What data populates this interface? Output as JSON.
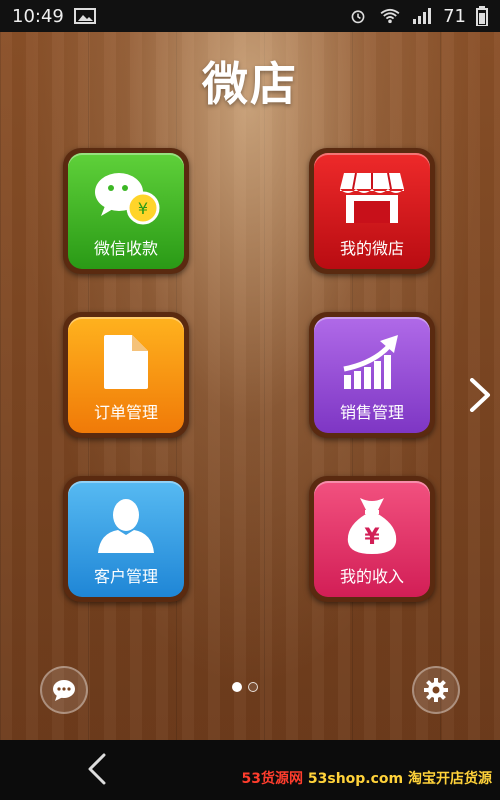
{
  "status_bar": {
    "time": "10:49",
    "battery": "71"
  },
  "app": {
    "title": "微店"
  },
  "tiles": [
    {
      "label": "微信收款",
      "icon": "wechat-money-icon",
      "color": "#3cb725"
    },
    {
      "label": "我的微店",
      "icon": "shop-icon",
      "color": "#d3141b"
    },
    {
      "label": "订单管理",
      "icon": "document-icon",
      "color": "#f59410"
    },
    {
      "label": "销售管理",
      "icon": "sales-chart-icon",
      "color": "#8f48d6"
    },
    {
      "label": "客户管理",
      "icon": "user-icon",
      "color": "#2f96e0"
    },
    {
      "label": "我的收入",
      "icon": "money-bag-icon",
      "color": "#e03366"
    }
  ],
  "pager": {
    "page": 1,
    "pages": 2
  },
  "watermark": {
    "brand": "53货源网",
    "url": "53shop.com",
    "slogan": "淘宝开店货源"
  }
}
